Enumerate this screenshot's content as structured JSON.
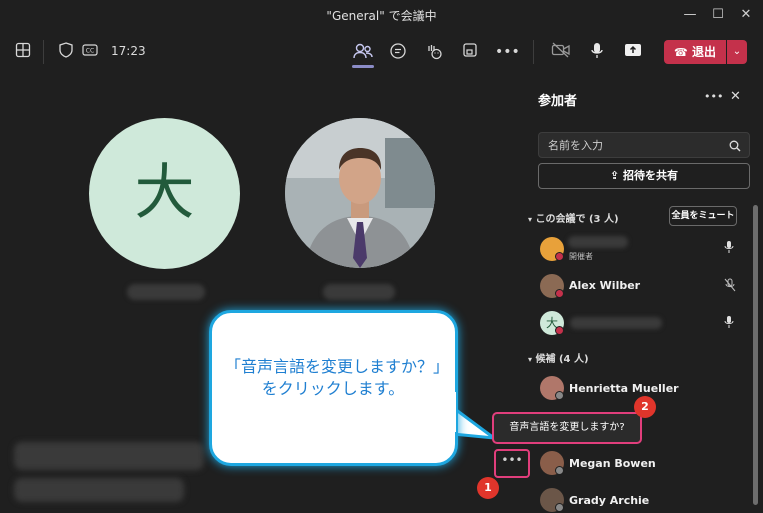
{
  "window": {
    "title": "\"General\" で会議中",
    "minimize": "—",
    "maximize": "☐",
    "close": "✕"
  },
  "toolbar": {
    "time": "17:23",
    "leave_label": "退出",
    "leave_caret": "⌄",
    "more": "•••"
  },
  "stage": {
    "avatar_initial": "大"
  },
  "callout": {
    "text": "「音声言語を変更しますか？」をクリックします。"
  },
  "panel": {
    "title": "参加者",
    "more": "•••",
    "close": "✕",
    "search_placeholder": "名前を入力",
    "invite_label": "招待を共有",
    "in_meeting_section": "この会議で (3 人)",
    "mute_all": "全員をミュート",
    "in_meeting": [
      {
        "name": "",
        "role": "開催者"
      },
      {
        "name": "Alex Wilber"
      },
      {
        "name": "",
        "initial": "大"
      }
    ],
    "suggested_section": "候補 (4 人)",
    "suggested": [
      {
        "name": "Henrietta Mueller"
      },
      {
        "name": "Megan Bowen"
      },
      {
        "name": "Grady Archie"
      }
    ]
  },
  "annotation": {
    "tooltip": "音声言語を変更しますか?",
    "more_button": "•••",
    "badge1": "1",
    "badge2": "2"
  },
  "colors": {
    "accent": "#8b8cc7",
    "leave": "#c4314b",
    "highlight": "#e13e7c",
    "callout_border": "#1ea7e0",
    "callout_text": "#1f7fd1",
    "badge": "#e0352b"
  }
}
